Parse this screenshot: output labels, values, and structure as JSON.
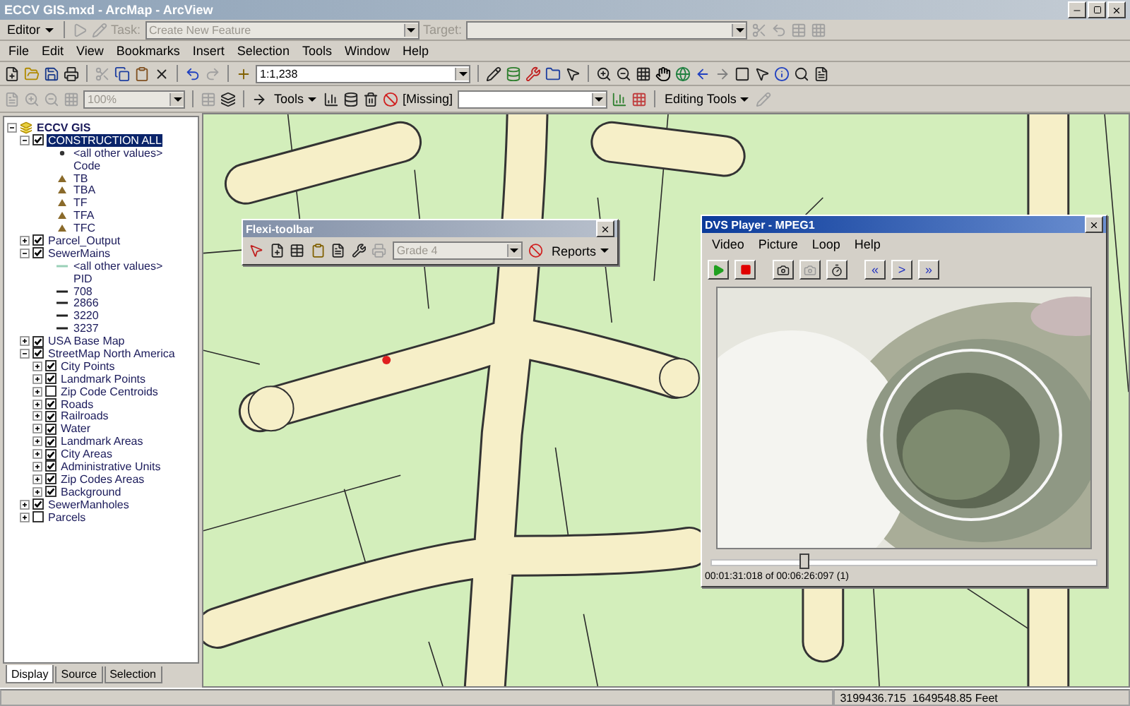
{
  "window": {
    "title": "ECCV GIS.mxd - ArcMap - ArcView"
  },
  "editor_toolbar": {
    "editor_menu": "Editor",
    "task_label": "Task:",
    "task": "Create New Feature",
    "target_label": "Target:",
    "disabled": true
  },
  "menu": [
    "File",
    "Edit",
    "View",
    "Bookmarks",
    "Insert",
    "Selection",
    "Tools",
    "Window",
    "Help"
  ],
  "standard_toolbar": {
    "scale": "1:1,238"
  },
  "tools_toolbar": {
    "zoom": "100%",
    "zoom_disabled": true,
    "tools_menu": "Tools",
    "missing": "[Missing]",
    "editing_tools": "Editing Tools"
  },
  "toc": {
    "items": [
      {
        "label": "ECCV GIS",
        "kind": "frame",
        "expanded": true,
        "children": [
          {
            "label": "CONSTRUCTION ALL",
            "kind": "layer",
            "checked": true,
            "expanded": true,
            "selected": true,
            "children": [
              {
                "label": "<all other values>",
                "kind": "dot"
              },
              {
                "label": "Code",
                "kind": "heading"
              },
              {
                "label": "TB",
                "kind": "triangle"
              },
              {
                "label": "TBA",
                "kind": "triangle"
              },
              {
                "label": "TF",
                "kind": "triangle"
              },
              {
                "label": "TFA",
                "kind": "triangle"
              },
              {
                "label": "TFC",
                "kind": "triangle"
              }
            ]
          },
          {
            "label": "Parcel_Output",
            "kind": "layer",
            "checked": true,
            "expanded": false,
            "selected": false
          },
          {
            "label": "SewerMains",
            "kind": "layer",
            "checked": true,
            "expanded": true,
            "selected": false,
            "children": [
              {
                "label": "<all other values>",
                "kind": "faint-line"
              },
              {
                "label": "PID",
                "kind": "heading"
              },
              {
                "label": "708",
                "kind": "line"
              },
              {
                "label": "2866",
                "kind": "line"
              },
              {
                "label": "3220",
                "kind": "line"
              },
              {
                "label": "3237",
                "kind": "line"
              }
            ]
          },
          {
            "label": "USA Base Map",
            "kind": "layer",
            "checked": true,
            "expanded": false,
            "selected": false
          },
          {
            "label": "StreetMap North America",
            "kind": "layer",
            "checked": true,
            "expanded": true,
            "selected": false,
            "children": [
              {
                "label": "City Points",
                "kind": "layer",
                "checked": true,
                "expanded": false,
                "selected": false
              },
              {
                "label": "Landmark Points",
                "kind": "layer",
                "checked": true,
                "expanded": false,
                "selected": false
              },
              {
                "label": "Zip Code Centroids",
                "kind": "layer",
                "checked": false,
                "expanded": false,
                "selected": false
              },
              {
                "label": "Roads",
                "kind": "layer",
                "checked": true,
                "expanded": false,
                "selected": false
              },
              {
                "label": "Railroads",
                "kind": "layer",
                "checked": true,
                "expanded": false,
                "selected": false
              },
              {
                "label": "Water",
                "kind": "layer",
                "checked": true,
                "expanded": false,
                "selected": false
              },
              {
                "label": "Landmark Areas",
                "kind": "layer",
                "checked": true,
                "expanded": false,
                "selected": false
              },
              {
                "label": "City Areas",
                "kind": "layer",
                "checked": true,
                "expanded": false,
                "selected": false
              },
              {
                "label": "Administrative Units",
                "kind": "layer",
                "checked": true,
                "expanded": false,
                "selected": false
              },
              {
                "label": "Zip Codes Areas",
                "kind": "layer",
                "checked": true,
                "expanded": false,
                "selected": false
              },
              {
                "label": "Background",
                "kind": "layer",
                "checked": true,
                "expanded": false,
                "selected": false
              }
            ]
          },
          {
            "label": "SewerManholes",
            "kind": "layer",
            "checked": true,
            "expanded": false,
            "selected": false
          },
          {
            "label": "Parcels",
            "kind": "layer",
            "checked": false,
            "expanded": false,
            "selected": false
          }
        ]
      }
    ]
  },
  "toc_tabs": [
    {
      "label": "Display",
      "selected": true
    },
    {
      "label": "Source",
      "selected": false
    },
    {
      "label": "Selection",
      "selected": false
    }
  ],
  "flexi_toolbar": {
    "title": "Flexi-toolbar",
    "grade": "Grade 4",
    "grade_disabled": true,
    "reports": "Reports"
  },
  "video_player": {
    "title": "DVS Player - MPEG1",
    "menu": [
      "Video",
      "Picture",
      "Loop",
      "Help"
    ],
    "nav": [
      "«",
      ">",
      "»"
    ],
    "position": {
      "level": 0.24
    },
    "time": "00:01:31:018 of 00:06:26:097 (1)"
  },
  "status_bar": {
    "coordinates": "3199436.715  1649548.85 Feet"
  }
}
